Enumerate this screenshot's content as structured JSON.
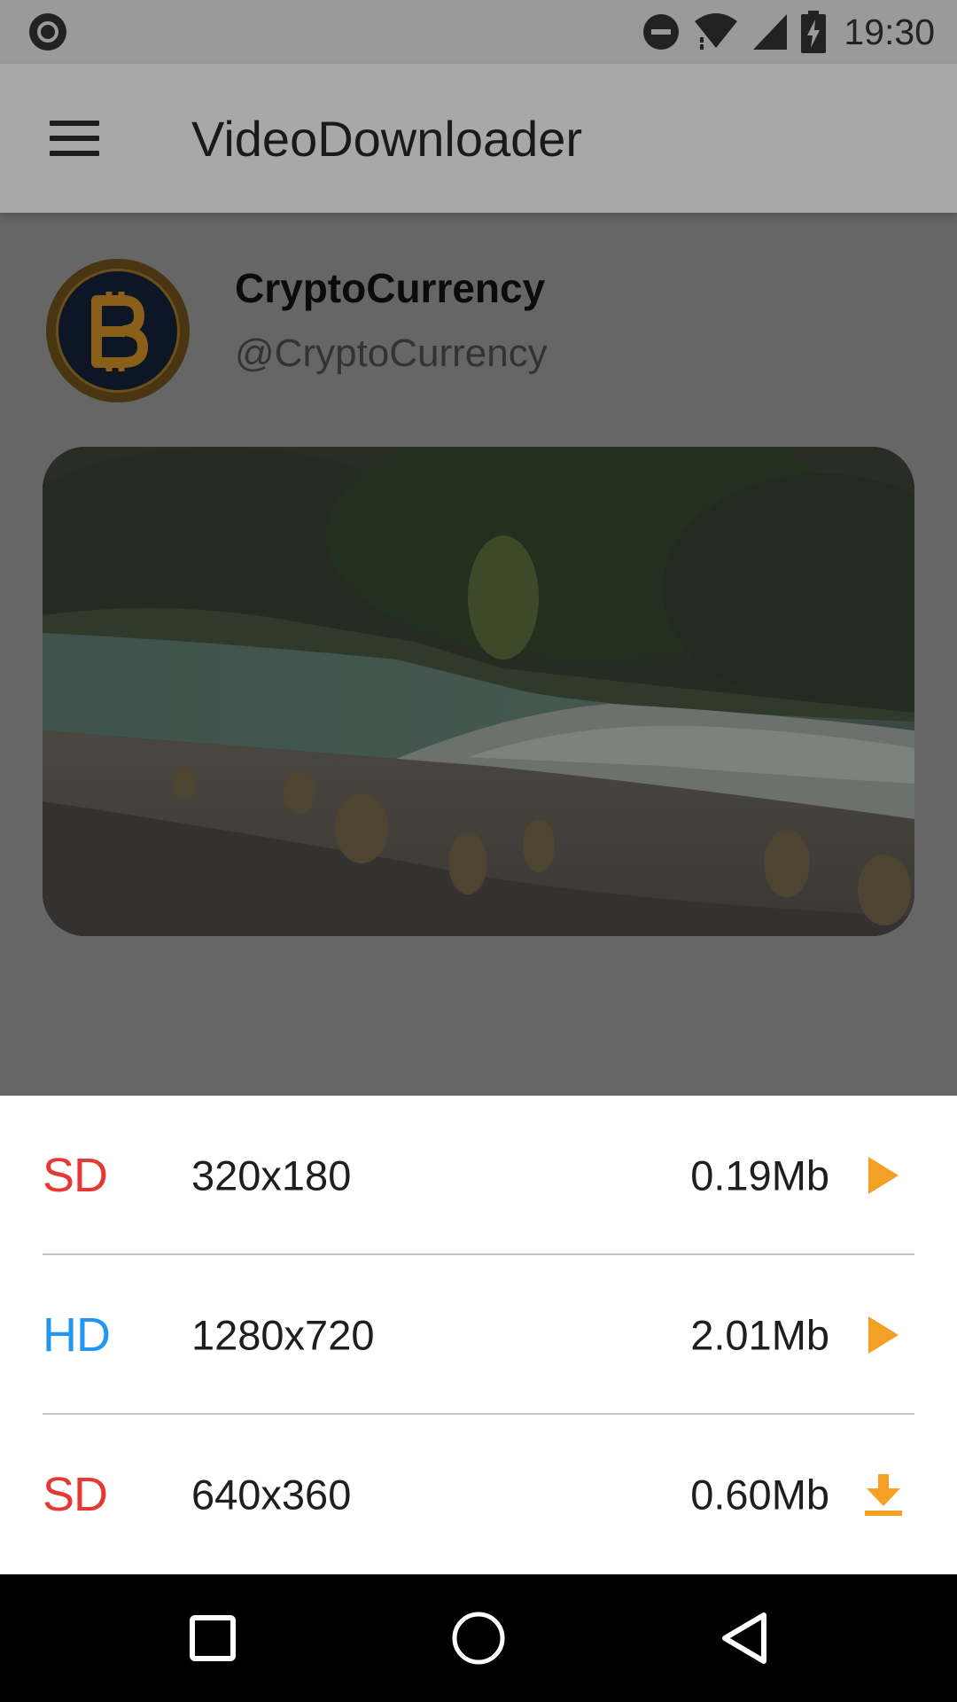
{
  "status_bar": {
    "time": "19:30",
    "icons": [
      "circle-icon",
      "do-not-disturb-icon",
      "wifi-icon",
      "signal-icon",
      "battery-charging-icon"
    ]
  },
  "toolbar": {
    "menu_icon": "hamburger-menu-icon",
    "title": "VideoDownloader"
  },
  "account": {
    "name": "CryptoCurrency",
    "handle": "@CryptoCurrency",
    "avatar_icon": "bitcoin-icon"
  },
  "video": {
    "thumbnail_icon": "river-landscape-image"
  },
  "options": [
    {
      "quality": "SD",
      "resolution": "320x180",
      "size": "0.19Mb",
      "action": "play-icon",
      "quality_color": "#e53935"
    },
    {
      "quality": "HD",
      "resolution": "1280x720",
      "size": "2.01Mb",
      "action": "play-icon",
      "quality_color": "#2196f3"
    },
    {
      "quality": "SD",
      "resolution": "640x360",
      "size": "0.60Mb",
      "action": "download-icon",
      "quality_color": "#e53935"
    }
  ],
  "colors": {
    "accent": "#f4a025",
    "sd": "#e53935",
    "hd": "#2196f3"
  },
  "nav_bar": {
    "buttons": [
      "recents-square-icon",
      "home-circle-icon",
      "back-triangle-icon"
    ]
  }
}
